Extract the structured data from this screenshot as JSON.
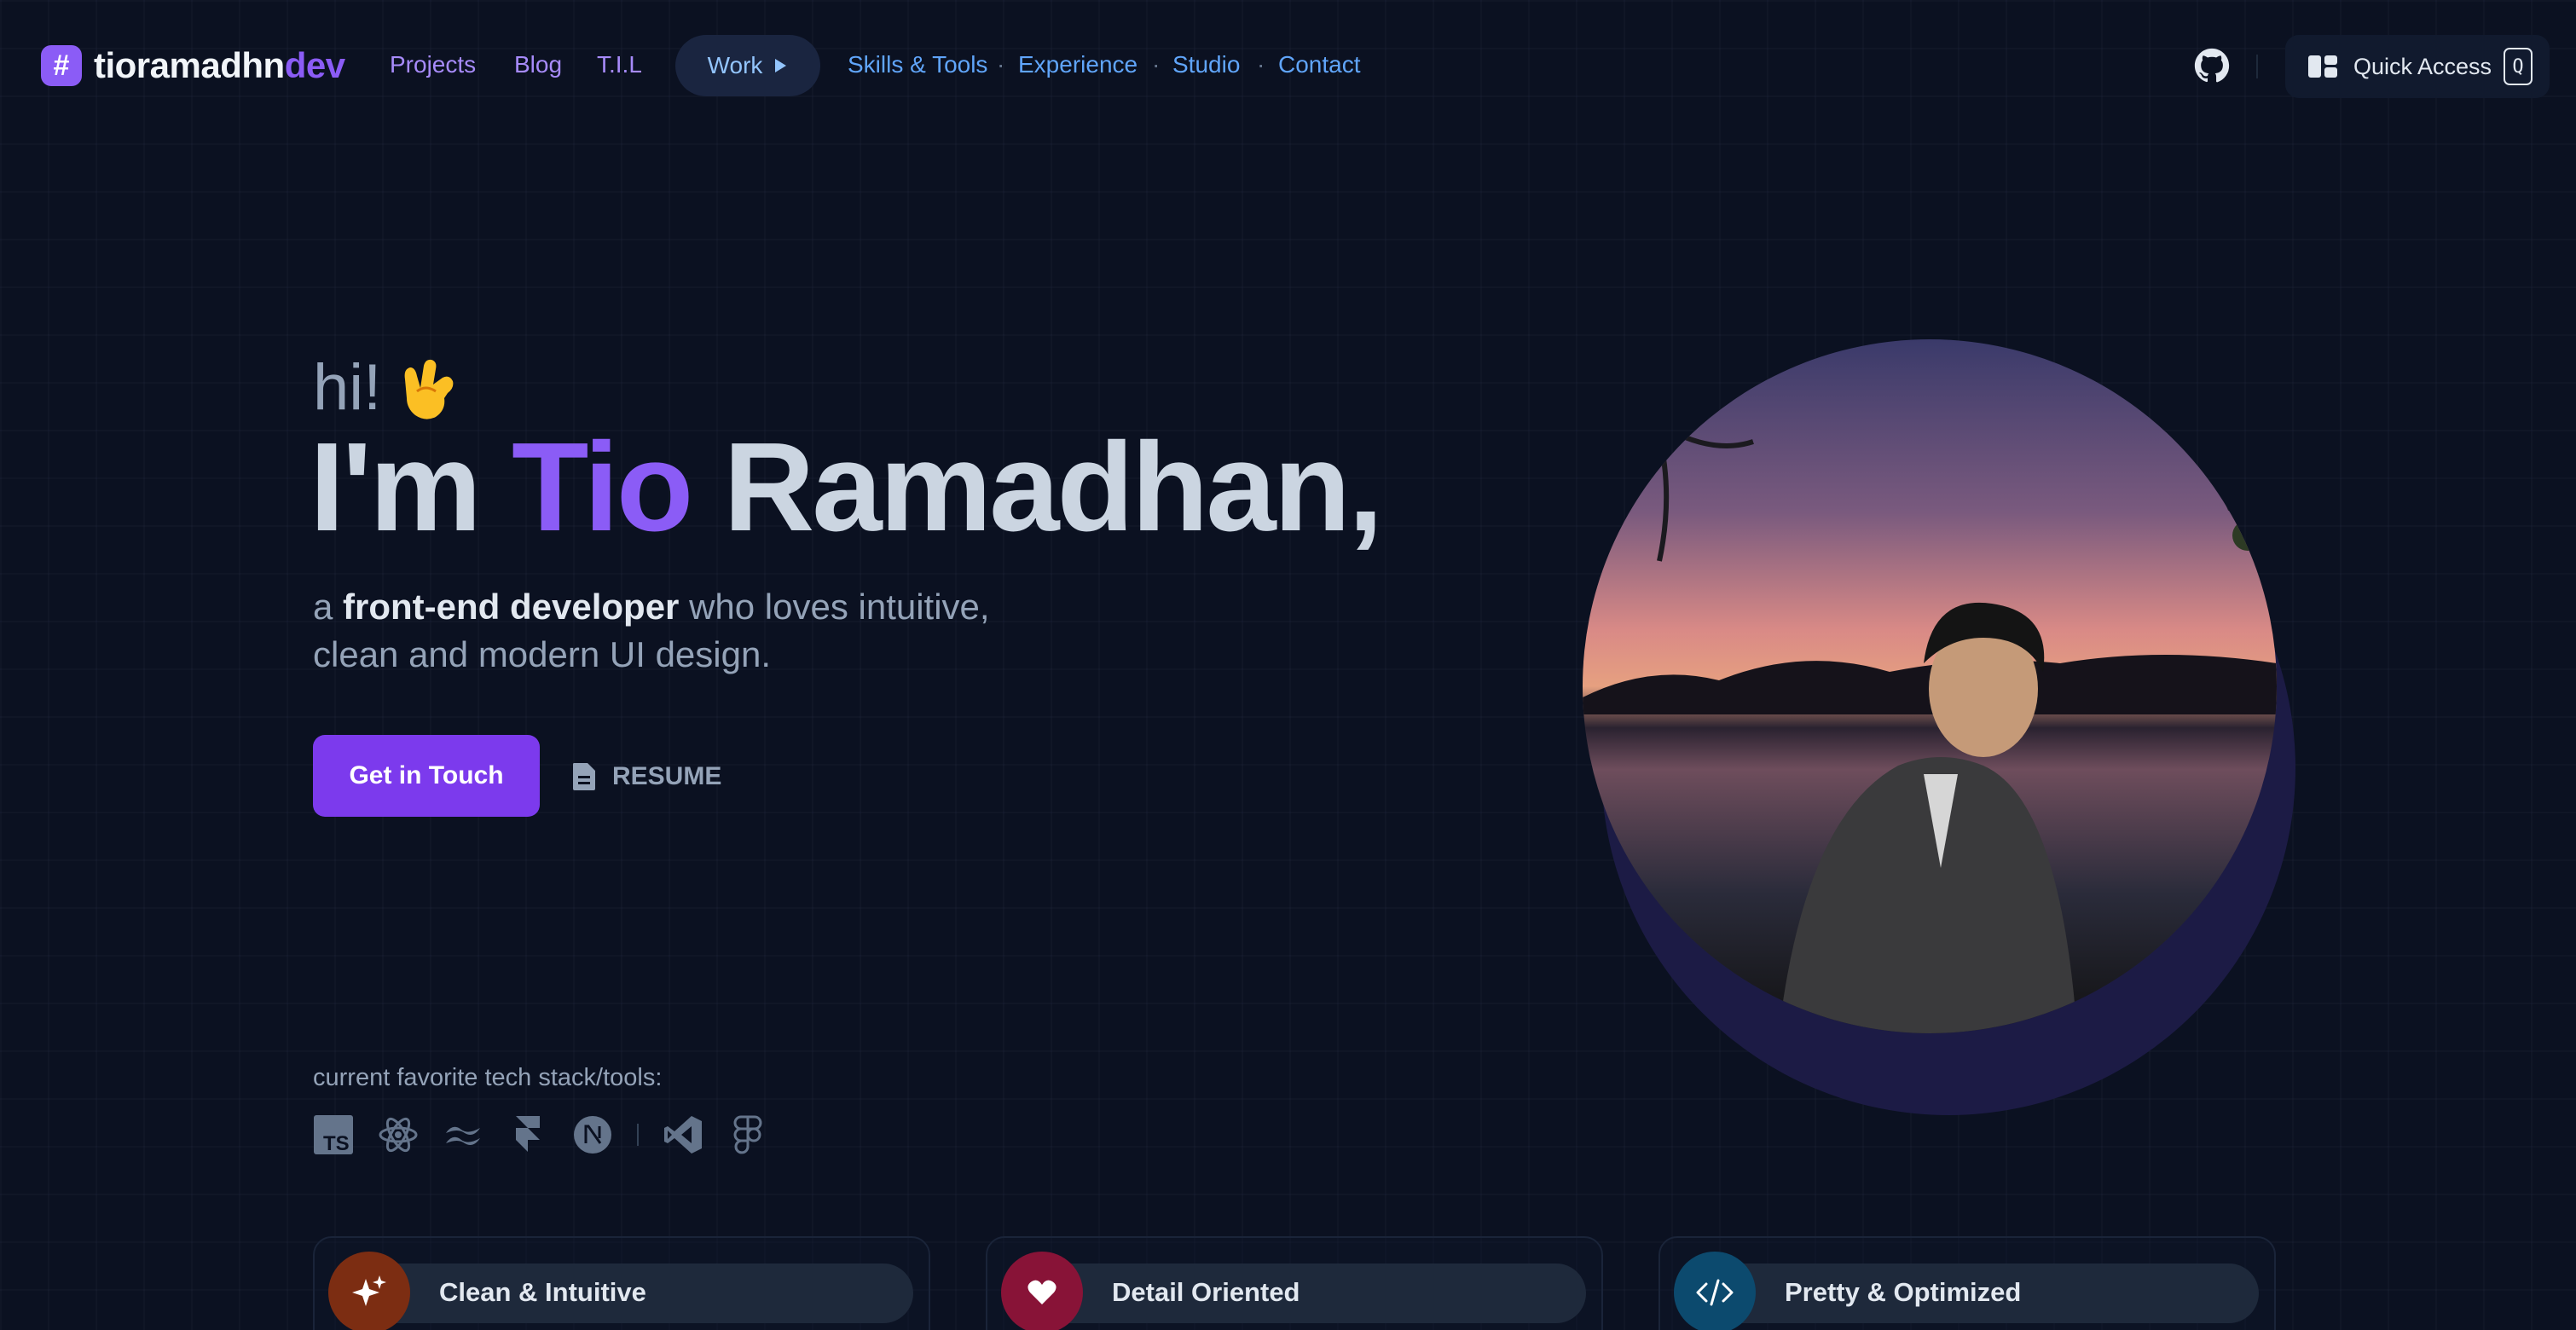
{
  "header": {
    "logo_badge": "#",
    "logo_main": "tioramadhn",
    "logo_accent": "dev",
    "nav": {
      "projects": "Projects",
      "blog": "Blog",
      "til": "T.I.L",
      "work": "Work",
      "skills": "Skills & Tools",
      "experience": "Experience",
      "studio": "Studio",
      "contact": "Contact",
      "separator": "·"
    },
    "github_icon": "github-icon",
    "quick_access_label": "Quick Access",
    "quick_access_key": "Q"
  },
  "hero": {
    "greeting": "hi!",
    "headline_prefix": "I'm ",
    "headline_name": "Tio",
    "headline_suffix": " Ramadhan,",
    "tagline_lead": "a ",
    "tagline_bold": "front-end developer",
    "tagline_rest": " who loves intuitive, clean and modern UI design.",
    "cta_label": "Get in Touch",
    "resume_label": "RESUME"
  },
  "stack": {
    "label": "current favorite tech stack/tools:",
    "icons": [
      "typescript-icon",
      "react-icon",
      "tailwind-icon",
      "framer-icon",
      "nextjs-icon",
      "vscode-icon",
      "figma-icon"
    ]
  },
  "features": [
    {
      "title": "Clean & Intuitive",
      "icon": "sparkles-icon",
      "color": "#7c2d12"
    },
    {
      "title": "Detail Oriented",
      "icon": "heart-icon",
      "color": "#881337"
    },
    {
      "title": "Pretty & Optimized",
      "icon": "code-icon",
      "color": "#0c4a6e"
    }
  ],
  "colors": {
    "background": "#0b1121",
    "accent": "#8b5cf6",
    "nav_blue": "#60a5fa",
    "text_muted": "#94a3b8"
  }
}
